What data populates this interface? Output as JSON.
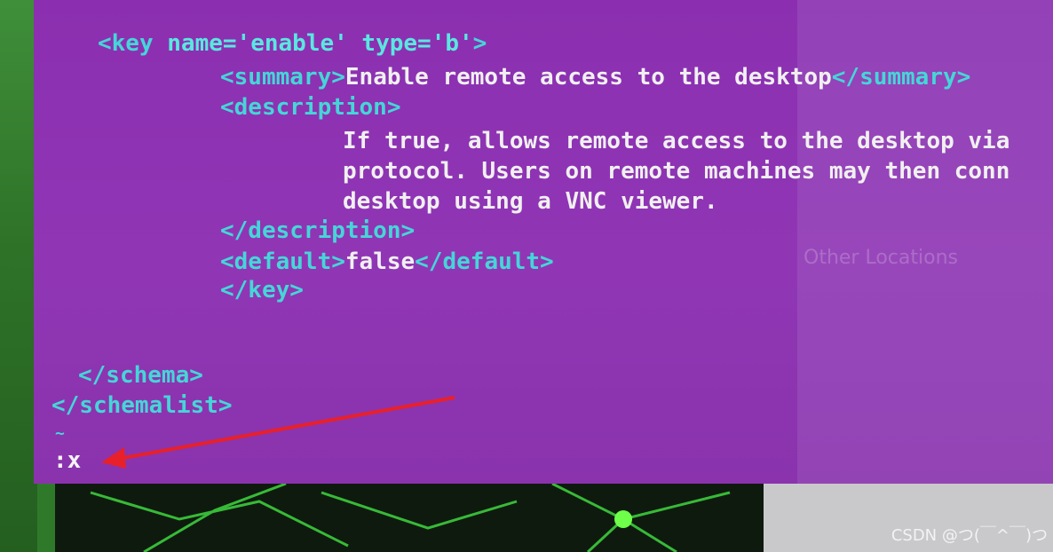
{
  "editor": {
    "lines": {
      "key_open": {
        "tag_start": "<key ",
        "attrs": "name='enable' type='b'",
        "tag_end": ">"
      },
      "summary": {
        "open": "<summary>",
        "text": "Enable remote access to the desktop",
        "close": "</summary>"
      },
      "description_open": "<description>",
      "desc_1": "If true, allows remote access to the desktop via",
      "desc_2": "protocol. Users on remote machines may then conn",
      "desc_3": "desktop using a VNC viewer.",
      "description_close": "</description>",
      "default": {
        "open": "<default>",
        "text": "false",
        "close": "</default>"
      },
      "key_close": "</key>",
      "schema_close": "</schema>",
      "schemalist_close": "</schemalist>",
      "tilde": "~"
    },
    "command_line": ":x"
  },
  "background": {
    "other_locations": "Other Locations"
  },
  "watermark": "CSDN @つ(￣^￣)つ",
  "colors": {
    "terminal_bg": "#8b2fb0",
    "tag": "#45d6d8",
    "text": "#f0f0f0",
    "arrow": "#e8202a"
  }
}
